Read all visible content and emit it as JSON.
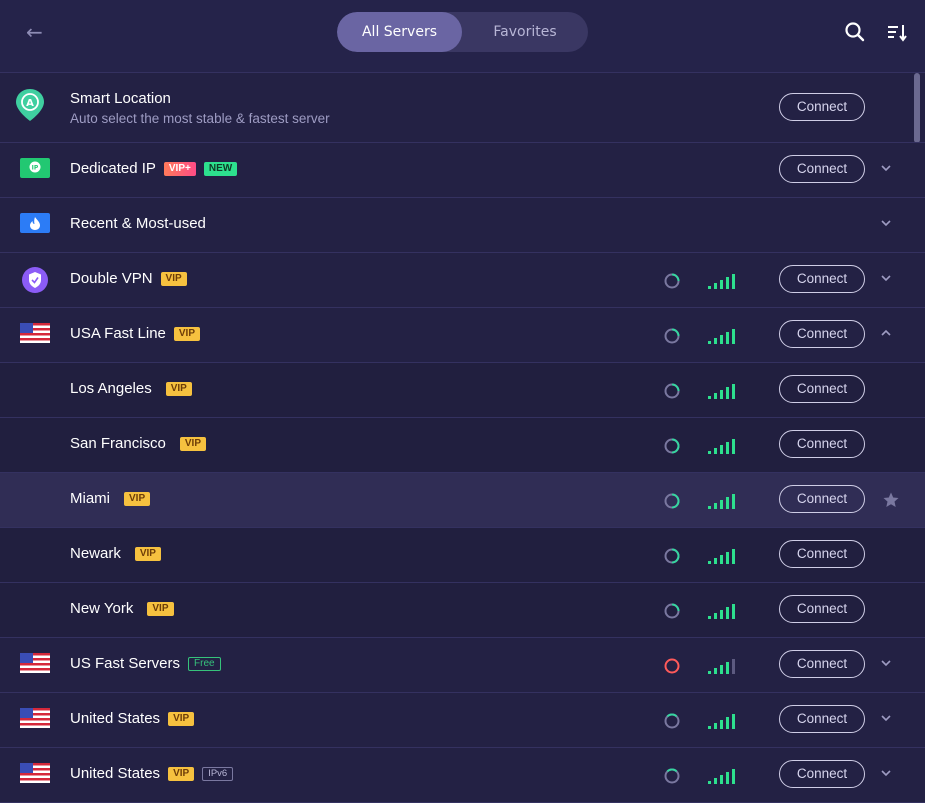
{
  "nav": {
    "back_label": "←"
  },
  "tabs": [
    {
      "label": "All Servers",
      "active": true
    },
    {
      "label": "Favorites",
      "active": false
    }
  ],
  "colors": {
    "background": "#232144",
    "accent": "#6a65a3",
    "vip": "#f6c13f",
    "signal": "#2de08e",
    "ping_ok": "#36d6a0",
    "ping_bad": "#ff5a5a"
  },
  "smart_location": {
    "title": "Smart Location",
    "subtitle": "Auto select the most stable & fastest server",
    "connect": "Connect"
  },
  "rows": [
    {
      "name": "Dedicated IP",
      "badges": [
        "VIP+",
        "NEW"
      ],
      "connect": "Connect",
      "icon": "ip-icon",
      "chevron": "down"
    },
    {
      "name": "Recent & Most-used",
      "badges": [],
      "icon": "fire-icon",
      "chevron": "down"
    },
    {
      "name": "Double VPN",
      "badges": [
        "VIP"
      ],
      "connect": "Connect",
      "icon": "shield-icon",
      "chevron": "down"
    },
    {
      "name": "USA Fast Line",
      "badges": [
        "VIP"
      ],
      "connect": "Connect",
      "icon": "us-flag-icon",
      "chevron": "up"
    },
    {
      "name": "Los Angeles",
      "badges": [
        "VIP"
      ],
      "connect": "Connect"
    },
    {
      "name": "San Francisco",
      "badges": [
        "VIP"
      ],
      "connect": "Connect"
    },
    {
      "name": "Miami",
      "badges": [
        "VIP"
      ],
      "connect": "Connect"
    },
    {
      "name": "Newark",
      "badges": [
        "VIP"
      ],
      "connect": "Connect"
    },
    {
      "name": "New York",
      "badges": [
        "VIP"
      ],
      "connect": "Connect"
    },
    {
      "name": "US Fast Servers",
      "badges": [
        "Free"
      ],
      "connect": "Connect",
      "icon": "us-flag-icon",
      "chevron": "down"
    },
    {
      "name": "United States",
      "badges": [
        "VIP"
      ],
      "connect": "Connect",
      "icon": "us-flag-icon",
      "chevron": "down"
    },
    {
      "name": "United States",
      "badges": [
        "VIP",
        "IPv6"
      ],
      "connect": "Connect",
      "icon": "us-flag-icon",
      "chevron": "down"
    }
  ]
}
